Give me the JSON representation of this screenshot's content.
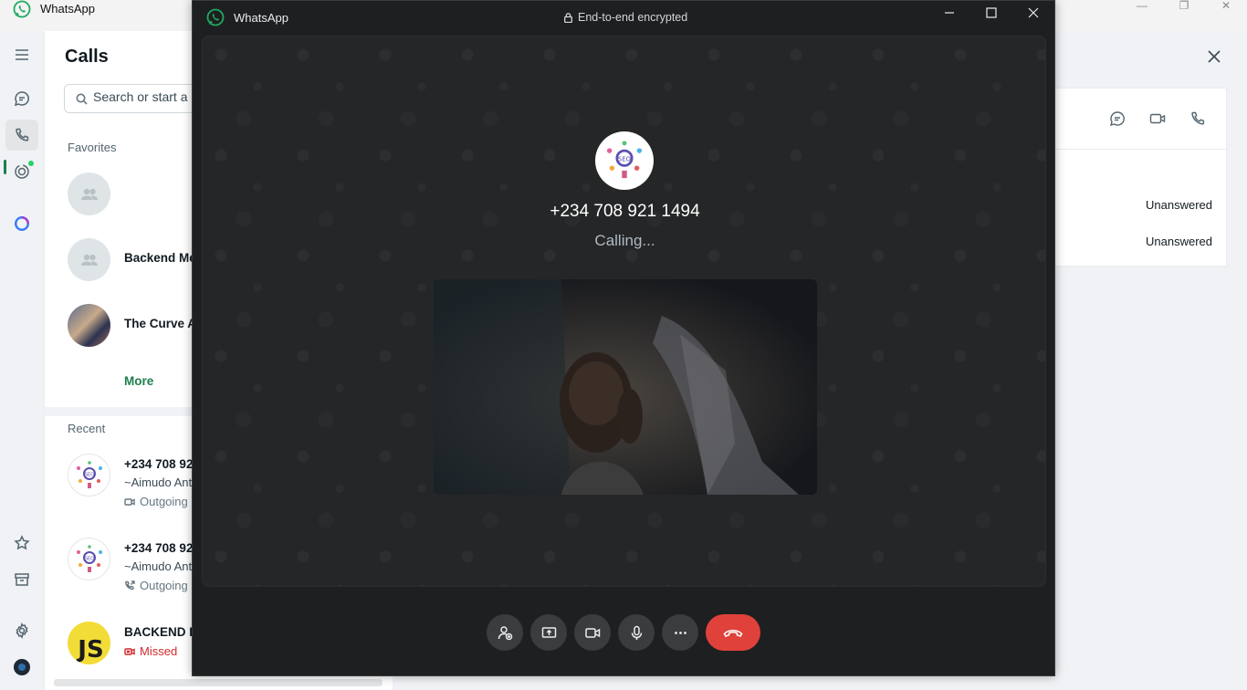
{
  "app": {
    "title": "WhatsApp",
    "accent_color": "#1d7f4c",
    "window_controls": [
      "minimize-icon",
      "restore-icon",
      "close-icon"
    ]
  },
  "rail": {
    "items": [
      {
        "name": "menu-icon"
      },
      {
        "name": "chats-icon"
      },
      {
        "name": "calls-icon",
        "active": true
      },
      {
        "name": "status-icon",
        "has_badge": true
      },
      {
        "name": "meta-ai-icon"
      },
      {
        "name": "starred-icon"
      },
      {
        "name": "archived-icon"
      },
      {
        "name": "settings-icon"
      },
      {
        "name": "profile-avatar"
      }
    ]
  },
  "calls": {
    "title": "Calls",
    "search_placeholder": "Search or start a n",
    "favorites_label": "Favorites",
    "favorites": [
      {
        "name": "",
        "avatar": "group"
      },
      {
        "name": "Backend Mem",
        "avatar": "group"
      },
      {
        "name": "The Curve Af",
        "avatar": "photo"
      }
    ],
    "more_label": "More",
    "recent_label": "Recent",
    "recent": [
      {
        "name": "+234 708 92",
        "sub": "~Aimudo Ant",
        "type": "Outgoing",
        "type_icon": "video-icon",
        "avatar": "seo"
      },
      {
        "name": "+234 708 92",
        "sub": "~Aimudo Ant",
        "type": "Outgoing",
        "type_icon": "outgoing-call-icon",
        "avatar": "seo"
      },
      {
        "name": "BACKEND DE",
        "sub": "",
        "type": "Missed",
        "type_icon": "missed-video-icon",
        "avatar": "js",
        "avatar_text": "JS"
      }
    ]
  },
  "detail": {
    "actions": [
      "chat-icon",
      "video-call-icon",
      "voice-call-icon"
    ],
    "entries": [
      "Unanswered",
      "Unanswered"
    ]
  },
  "call_window": {
    "title": "WhatsApp",
    "encryption_label": "End-to-end encrypted",
    "callee_number": "+234 708 921 1494",
    "status": "Calling...",
    "end_call_color": "#e0413b",
    "controls": [
      "add-participant-icon",
      "share-screen-icon",
      "camera-icon",
      "microphone-icon",
      "more-options-icon",
      "end-call-icon"
    ]
  }
}
